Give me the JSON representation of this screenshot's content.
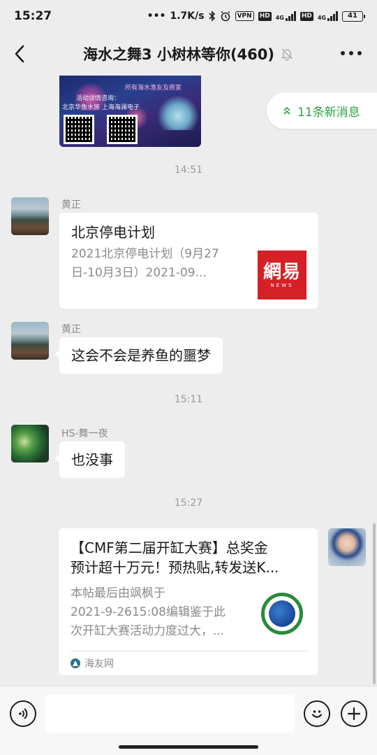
{
  "status": {
    "time": "15:27",
    "speed": "1.7K/s",
    "vpn": "VPN",
    "hd": "HD",
    "net": "4G",
    "battery": "41"
  },
  "header": {
    "title": "海水之舞3 小树林等你(460)"
  },
  "new_messages": "11条新消息",
  "image_message": {
    "text_top": "所有海水渔友及商家",
    "text_mid": "活动详情咨询：",
    "text_left": "北京华鱼水族  上海海澜电子"
  },
  "messages": [
    {
      "timestamp": "14:51"
    },
    {
      "sender": "黄正",
      "type": "link_card",
      "title": "北京停电计划",
      "desc_line1": "2021北京停电计划（9月27",
      "desc_line2": "日-10月3日）2021-09...",
      "logo_big": "網易",
      "logo_small": "NEWS"
    },
    {
      "sender": "黄正",
      "type": "text",
      "text": "这会不会是养鱼的噩梦"
    },
    {
      "timestamp": "15:11"
    },
    {
      "sender": "HS-舞一夜",
      "type": "text",
      "text": "也没事"
    },
    {
      "timestamp": "15:27"
    },
    {
      "sender": "me",
      "type": "link_card",
      "title_line1": "【CMF第二届开缸大赛】总奖金",
      "title_line2": "预计超十万元！预热贴,转发送K...",
      "desc_line1": "本帖最后由飒枫于",
      "desc_line2": "2021-9-2615:08编辑鉴于此",
      "desc_line3": "次开缸大赛活动力度过大，...",
      "source": "海友网"
    }
  ],
  "input": {
    "placeholder": ""
  }
}
